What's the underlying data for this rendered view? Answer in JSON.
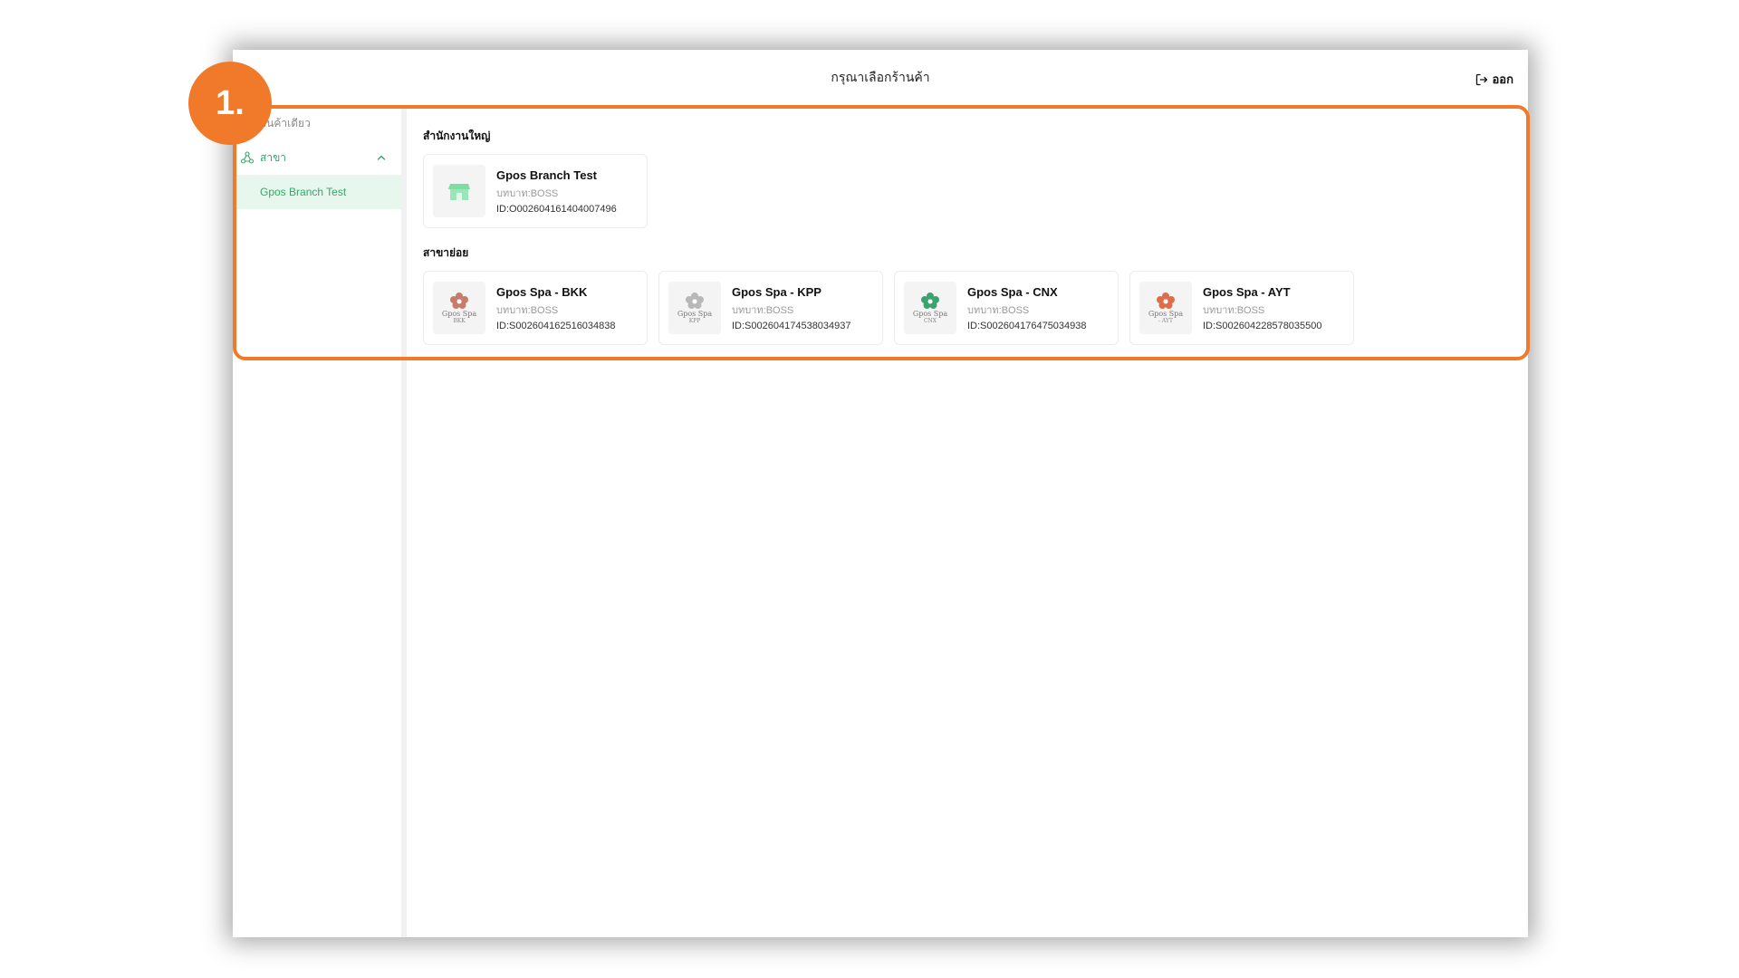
{
  "header": {
    "title": "กรุณาเลือกร้านค้า",
    "logout_label": "ออก",
    "logout_icon": "logout-icon"
  },
  "sidebar": {
    "section_label": "ร้านค้าเดียว",
    "group": {
      "label": "สาขา",
      "icon": "branches-icon",
      "expanded": true
    },
    "items": [
      {
        "label": "Gpos Branch Test",
        "selected": true
      }
    ]
  },
  "main": {
    "headquarters": {
      "title": "สำนักงานใหญ่",
      "cards": [
        {
          "name": "Gpos Branch Test",
          "role": "บทบาท:BOSS",
          "id": "ID:O002604161404007496",
          "logo": "store-icon"
        }
      ]
    },
    "branches": {
      "title": "สาขาย่อย",
      "cards": [
        {
          "name": "Gpos Spa - BKK",
          "role": "บทบาท:BOSS",
          "id": "ID:S002604162516034838",
          "logo_title": "Gpos Spa",
          "logo_sub": "BKK",
          "logo_color": "#c97b6b"
        },
        {
          "name": "Gpos Spa - KPP",
          "role": "บทบาท:BOSS",
          "id": "ID:S002604174538034937",
          "logo_title": "Gpos Spa",
          "logo_sub": "KPP",
          "logo_color": "#b8b8b8"
        },
        {
          "name": "Gpos Spa - CNX",
          "role": "บทบาท:BOSS",
          "id": "ID:S002604176475034938",
          "logo_title": "Gpos Spa",
          "logo_sub": "CNX",
          "logo_color": "#3aa36e"
        },
        {
          "name": "Gpos Spa - AYT",
          "role": "บทบาท:BOSS",
          "id": "ID:S002604228578035500",
          "logo_title": "Gpos Spa",
          "logo_sub": "- AYT",
          "logo_color": "#e06d4a"
        }
      ]
    }
  },
  "annotation": {
    "step_label": "1.",
    "color": "#f07a2a"
  },
  "colors": {
    "accent_green": "#34a86a",
    "selected_bg": "#e8f7ee"
  }
}
